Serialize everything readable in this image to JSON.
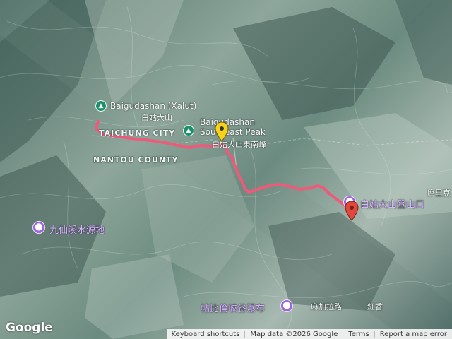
{
  "map": {
    "route_color": "#ee5a7a",
    "pin_peak_color": "#1f8f6b",
    "pin_purple_color": "#9a68d9",
    "marker_start_color": "#f6d21a",
    "marker_end_color": "#e0483e"
  },
  "labels": {
    "baigudashan_en": "Baigudashan (Xalut)",
    "baigudashan_zh": "白姑大山",
    "southeast_peak_en_line1": "Baigudashan",
    "southeast_peak_en_line2": "Southeast Peak",
    "southeast_peak_zh": "白姑大山東南峰",
    "taichung": "TAICHUNG CITY",
    "nantou": "NANTOU COUNTY",
    "trailhead_zh": "白姑大山登山口",
    "jiuxian": "九仙溪水源地",
    "waterfall": "帖比倫峽谷瀑布",
    "majiala": "麻加拉路",
    "hongxiang": "紅香",
    "moli": "摩里克"
  },
  "footer": {
    "google": "Google",
    "shortcuts": "Keyboard shortcuts",
    "mapdata": "Map data ©2026 Google",
    "terms": "Terms",
    "report": "Report a map error"
  }
}
